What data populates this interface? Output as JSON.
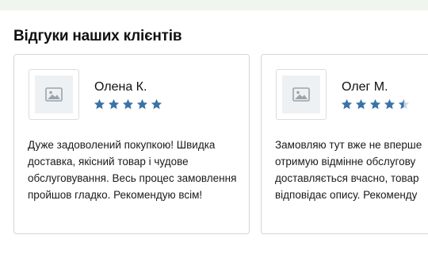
{
  "section": {
    "title": "Відгуки наших клієнтів"
  },
  "colors": {
    "star": "#3b73a8",
    "star_empty": "#c9d6e3"
  },
  "reviews": [
    {
      "name": "Олена К.",
      "rating": 5,
      "text": "Дуже задоволений покупкою! Швидка доставка, якісний товар і чудове обслуговування. Весь процес замовлення пройшов гладко. Рекомендую всім!"
    },
    {
      "name": "Олег М.",
      "rating": 4.5,
      "text_lines": [
        "Замовляю тут вже не вперше",
        "отримую відмінне обслугову",
        "доставляється вчасно, товар",
        "відповідає опису. Рекоменду"
      ]
    }
  ]
}
